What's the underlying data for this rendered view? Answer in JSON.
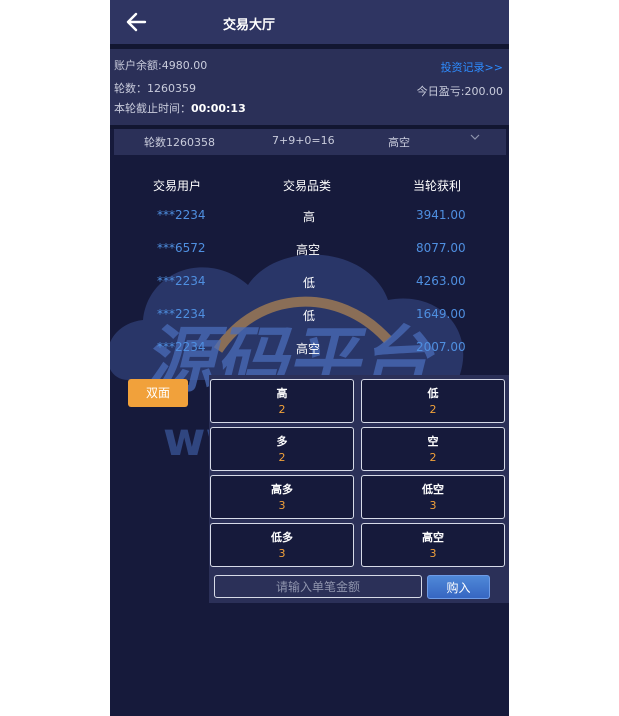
{
  "header": {
    "title": "交易大厅",
    "back_icon": "arrow-left-icon"
  },
  "account": {
    "balance": "账户余额:4980.00",
    "round": "轮数：1260359",
    "deadline_label": "本轮截止时间：",
    "deadline_value": "00:00:13",
    "invest_link": "投资记录>>",
    "profit": "今日盈亏:200.00"
  },
  "last_round": {
    "round": "轮数1260358",
    "formula": "7+9+0=16",
    "result": "高空",
    "chevron_icon": "chevron-down-icon"
  },
  "table": {
    "headers": [
      "交易用户",
      "交易品类",
      "当轮获利"
    ],
    "rows": [
      {
        "user": "***2234",
        "type": "高",
        "amount": "3941.00"
      },
      {
        "user": "***6572",
        "type": "高空",
        "amount": "8077.00"
      },
      {
        "user": "***2234",
        "type": "低",
        "amount": "4263.00"
      },
      {
        "user": "***2234",
        "type": "低",
        "amount": "1649.00"
      },
      {
        "user": "***2234",
        "type": "高空",
        "amount": "2007.00"
      }
    ]
  },
  "bet": {
    "tab": "双面",
    "options": [
      {
        "label": "高",
        "odds": "2"
      },
      {
        "label": "低",
        "odds": "2"
      },
      {
        "label": "多",
        "odds": "2"
      },
      {
        "label": "空",
        "odds": "2"
      },
      {
        "label": "高多",
        "odds": "3"
      },
      {
        "label": "低空",
        "odds": "3"
      },
      {
        "label": "低多",
        "odds": "3"
      },
      {
        "label": "高空",
        "odds": "3"
      }
    ],
    "input_placeholder": "请输入单笔金额",
    "buy_label": "购入"
  },
  "watermark": {
    "text": "源码平台",
    "url": "www.ympt.cc"
  },
  "colors": {
    "accent": "#f1a13b",
    "link": "#2e8cff",
    "background": "#161a3b",
    "panel": "#2b3058"
  }
}
